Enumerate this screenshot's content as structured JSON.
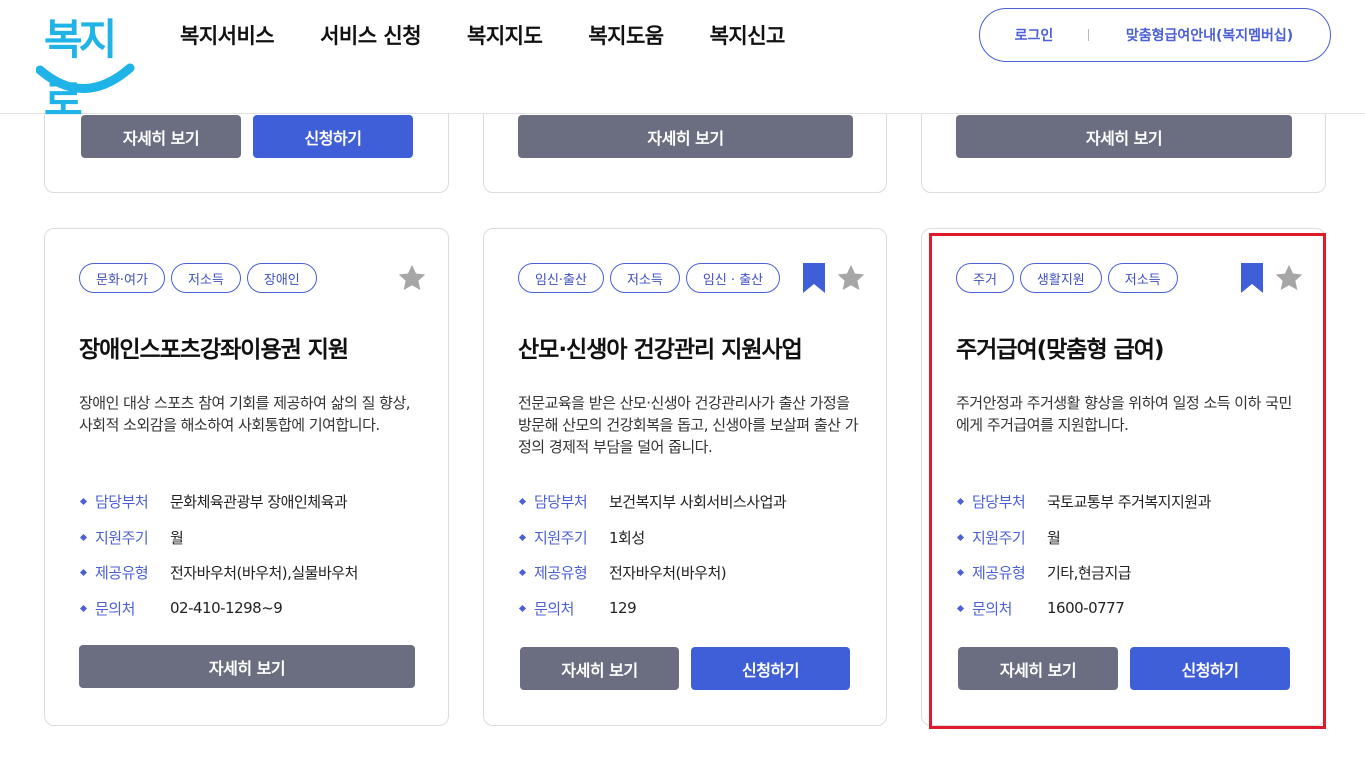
{
  "header": {
    "logo_text": "복지로",
    "nav": [
      "복지서비스",
      "서비스 신청",
      "복지지도",
      "복지도움",
      "복지신고"
    ],
    "login_label": "로그인",
    "guide_label": "맞춤형급여안내(복지멤버십)"
  },
  "top_cards": [
    {
      "detail_label": "자세히 보기",
      "apply_label": "신청하기"
    },
    {
      "detail_label": "자세히 보기"
    },
    {
      "detail_label": "자세히 보기"
    }
  ],
  "cards": [
    {
      "tags": [
        "문화·여가",
        "저소득",
        "장애인"
      ],
      "title": "장애인스포츠강좌이용권 지원",
      "description": "장애인 대상 스포츠 참여 기회를 제공하여 삶의 질 향상, 사회적 소외감을 해소하여 사회통합에 기여합니다.",
      "info": [
        {
          "label": "담당부처",
          "value": "문화체육관광부 장애인체육과"
        },
        {
          "label": "지원주기",
          "value": "월"
        },
        {
          "label": "제공유형",
          "value": "전자바우처(바우처),실물바우처"
        },
        {
          "label": "문의처",
          "value": "02-410-1298~9"
        }
      ],
      "detail_label": "자세히 보기"
    },
    {
      "tags": [
        "임신·출산",
        "저소득",
        "임신 · 출산"
      ],
      "title": "산모·신생아 건강관리 지원사업",
      "description": "전문교육을 받은 산모·신생아 건강관리사가 출산 가정을 방문해 산모의 건강회복을 돕고, 신생아를 보살펴 출산 가정의 경제적 부담을 덜어 줍니다.",
      "info": [
        {
          "label": "담당부처",
          "value": "보건복지부 사회서비스사업과"
        },
        {
          "label": "지원주기",
          "value": "1회성"
        },
        {
          "label": "제공유형",
          "value": "전자바우처(바우처)"
        },
        {
          "label": "문의처",
          "value": "129"
        }
      ],
      "detail_label": "자세히 보기",
      "apply_label": "신청하기"
    },
    {
      "tags": [
        "주거",
        "생활지원",
        "저소득"
      ],
      "title": "주거급여(맞춤형 급여)",
      "description": "주거안정과 주거생활 향상을 위하여 일정 소득 이하 국민에게 주거급여를 지원합니다.",
      "info": [
        {
          "label": "담당부처",
          "value": "국토교통부 주거복지지원과"
        },
        {
          "label": "지원주기",
          "value": "월"
        },
        {
          "label": "제공유형",
          "value": "기타,현금지급"
        },
        {
          "label": "문의처",
          "value": "1600-0777"
        }
      ],
      "detail_label": "자세히 보기",
      "apply_label": "신청하기"
    }
  ],
  "colors": {
    "accent": "#3f5fd9",
    "button_gray": "#6b6e80",
    "highlight": "#e0192b",
    "logo": "#1fb3e8"
  }
}
